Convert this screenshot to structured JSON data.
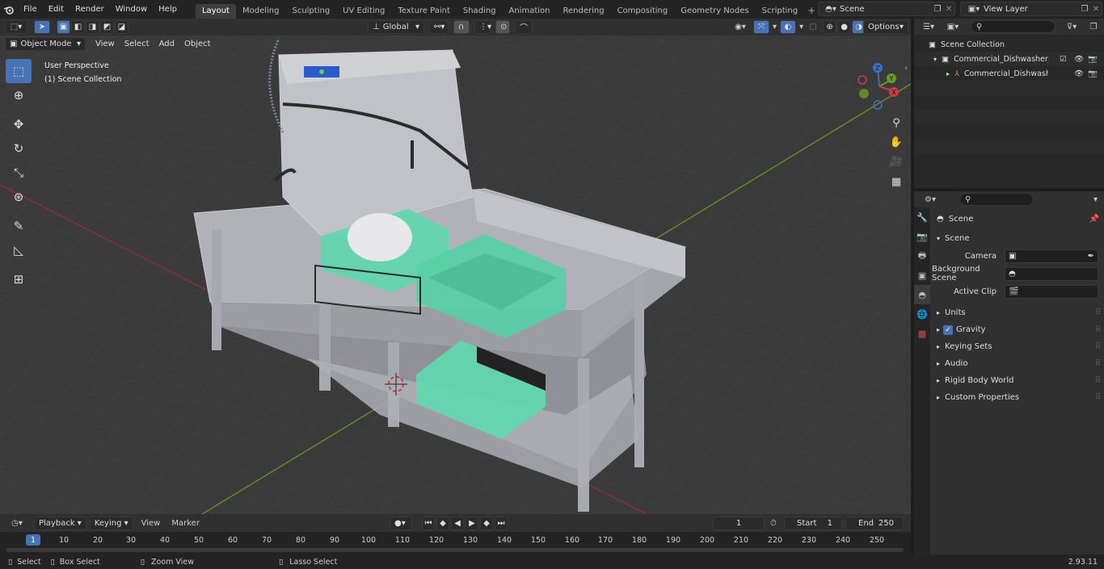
{
  "app": {
    "logo": "blender-logo"
  },
  "menu": [
    "File",
    "Edit",
    "Render",
    "Window",
    "Help"
  ],
  "workspaces": [
    "Layout",
    "Modeling",
    "Sculpting",
    "UV Editing",
    "Texture Paint",
    "Shading",
    "Animation",
    "Rendering",
    "Compositing",
    "Geometry Nodes",
    "Scripting"
  ],
  "active_workspace": "Layout",
  "scene_selector": {
    "value": "Scene"
  },
  "view_layer_selector": {
    "value": "View Layer"
  },
  "viewport_header": {
    "mode": "Object Mode",
    "menus": [
      "View",
      "Select",
      "Add",
      "Object"
    ],
    "orientation": "Global",
    "options": "Options"
  },
  "viewport_info": {
    "line1": "User Perspective",
    "line2": "(1) Scene Collection"
  },
  "gizmo": {
    "z": "Z",
    "y": "Y",
    "x": "X"
  },
  "outliner": {
    "root": "Scene Collection",
    "items": [
      {
        "label": "Commercial_Dishwasher_with"
      },
      {
        "label": "Commercial_Dishwasher"
      }
    ]
  },
  "properties": {
    "header": "Scene",
    "panel": "Scene",
    "fields": [
      {
        "label": "Camera",
        "value": ""
      },
      {
        "label": "Background Scene",
        "value": ""
      },
      {
        "label": "Active Clip",
        "value": ""
      }
    ],
    "sections": [
      "Units",
      "Gravity",
      "Keying Sets",
      "Audio",
      "Rigid Body World",
      "Custom Properties"
    ],
    "gravity_checked": true
  },
  "timeline": {
    "menus": [
      "Playback",
      "Keying",
      "View",
      "Marker"
    ],
    "current_frame": "1",
    "start_label": "Start",
    "start": "1",
    "end_label": "End",
    "end": "250",
    "ruler": [
      "1",
      "10",
      "20",
      "30",
      "40",
      "50",
      "60",
      "70",
      "80",
      "90",
      "100",
      "110",
      "120",
      "130",
      "140",
      "150",
      "160",
      "170",
      "180",
      "190",
      "200",
      "210",
      "220",
      "230",
      "240",
      "250"
    ]
  },
  "status": {
    "select": "Select",
    "box_select": "Box Select",
    "zoom_view": "Zoom View",
    "lasso_select": "Lasso Select",
    "version": "2.93.11"
  }
}
